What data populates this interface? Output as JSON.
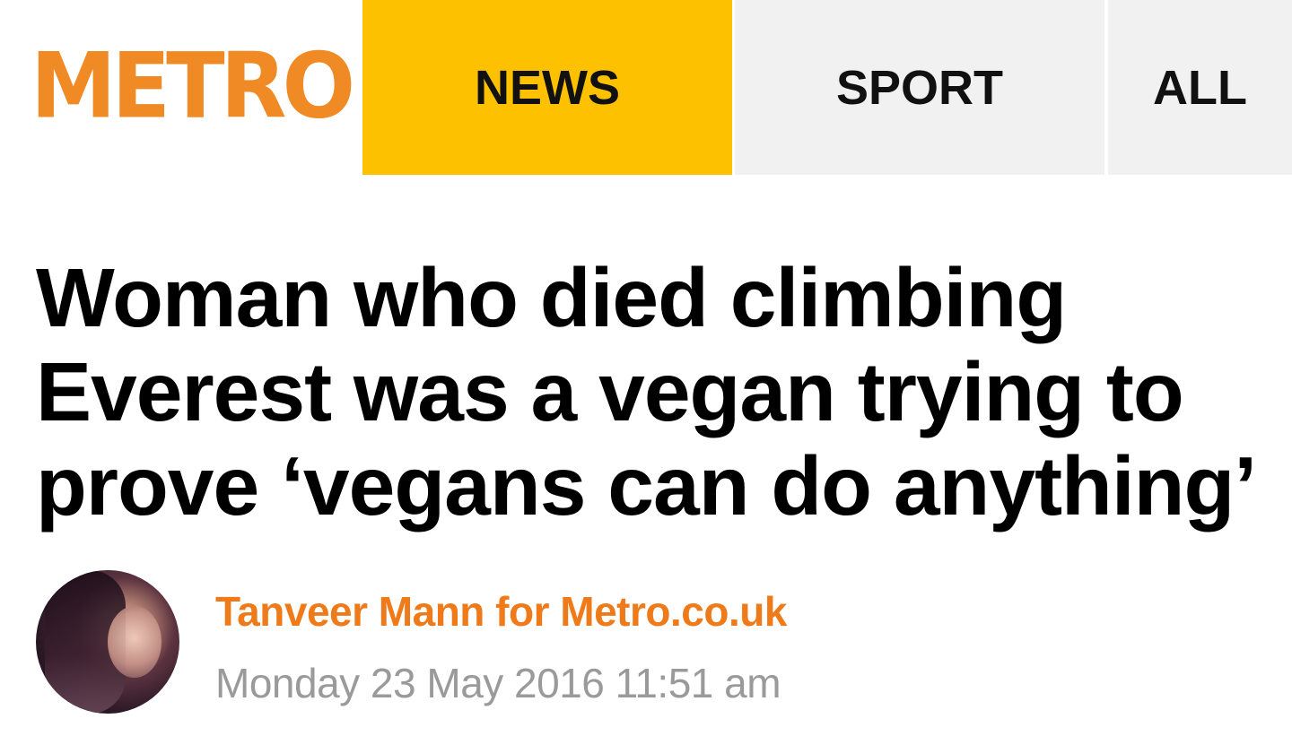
{
  "header": {
    "logo_text": "METRO",
    "tabs": [
      {
        "label": "NEWS",
        "active": true
      },
      {
        "label": "SPORT",
        "active": false
      },
      {
        "label": "ALL",
        "active": false
      }
    ]
  },
  "article": {
    "headline": "Woman who died climbing Everest was a vegan trying to prove ‘vegans can do anything’",
    "byline": "Tanveer Mann for Metro.co.uk",
    "date": "Monday 23 May 2016 11:51 am"
  },
  "colors": {
    "brand_orange": "#f08a24",
    "active_tab": "#fec100",
    "inactive_tab": "#f1f1f1",
    "byline": "#ef7a1a",
    "date": "#9a9a9a"
  }
}
